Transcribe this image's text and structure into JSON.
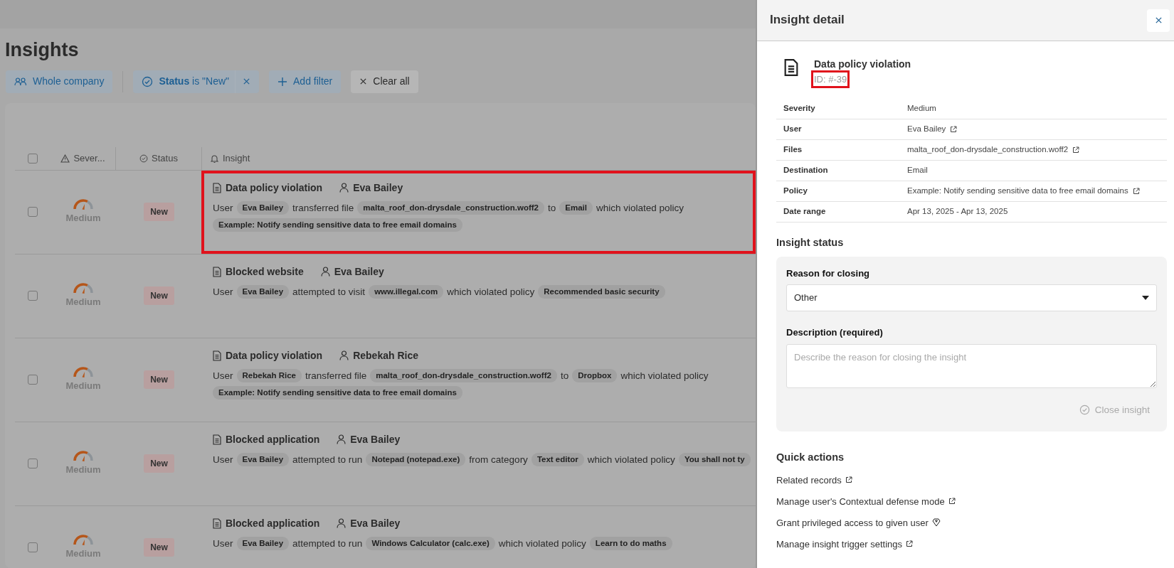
{
  "page": {
    "title": "Insights"
  },
  "filters": [
    {
      "kind": "scope",
      "label": "Whole company"
    },
    {
      "kind": "status",
      "label": "**Status** is \"New\"",
      "removable": true
    },
    {
      "kind": "add",
      "label": "Add filter"
    },
    {
      "kind": "clear",
      "label": "Clear all"
    }
  ],
  "table": {
    "select_all": {
      "checked": false
    },
    "columns": [
      {
        "kind": "severity",
        "label": "Sever..."
      },
      {
        "kind": "status",
        "label": "Status"
      },
      {
        "kind": "insight",
        "label": "Insight"
      }
    ],
    "rows": [
      {
        "checked": false,
        "severity": "Medium",
        "status": "New",
        "highlighted": true,
        "type": "Data policy violation",
        "user": "Eva Bailey",
        "lines": [
          [
            {
              "kind": "text",
              "text": "User"
            },
            {
              "kind": "chip",
              "text": "Eva Bailey"
            },
            {
              "kind": "text",
              "text": "transferred file"
            },
            {
              "kind": "chip",
              "text": "malta_roof_don-drysdale_construction.woff2"
            },
            {
              "kind": "text",
              "text": "to"
            },
            {
              "kind": "chip",
              "text": "Email"
            },
            {
              "kind": "text",
              "text": "which violated policy"
            }
          ],
          [
            {
              "kind": "chip",
              "text": "Example: Notify sending sensitive data to free email domains"
            }
          ]
        ]
      },
      {
        "checked": false,
        "severity": "Medium",
        "status": "New",
        "highlighted": false,
        "type": "Blocked website",
        "user": "Eva Bailey",
        "lines": [
          [
            {
              "kind": "text",
              "text": "User"
            },
            {
              "kind": "chip",
              "text": "Eva Bailey"
            },
            {
              "kind": "text",
              "text": "attempted to visit"
            },
            {
              "kind": "chip",
              "text": "www.illegal.com"
            },
            {
              "kind": "text",
              "text": "which violated policy"
            },
            {
              "kind": "chip",
              "text": "Recommended basic security"
            }
          ]
        ]
      },
      {
        "checked": false,
        "severity": "Medium",
        "status": "New",
        "highlighted": false,
        "type": "Data policy violation",
        "user": "Rebekah Rice",
        "lines": [
          [
            {
              "kind": "text",
              "text": "User"
            },
            {
              "kind": "chip",
              "text": "Rebekah Rice"
            },
            {
              "kind": "text",
              "text": "transferred file"
            },
            {
              "kind": "chip",
              "text": "malta_roof_don-drysdale_construction.woff2"
            },
            {
              "kind": "text",
              "text": "to"
            },
            {
              "kind": "chip",
              "text": "Dropbox"
            },
            {
              "kind": "text",
              "text": "which violated policy"
            }
          ],
          [
            {
              "kind": "chip",
              "text": "Example: Notify sending sensitive data to free email domains"
            }
          ]
        ]
      },
      {
        "checked": false,
        "severity": "Medium",
        "status": "New",
        "highlighted": false,
        "type": "Blocked application",
        "user": "Eva Bailey",
        "lines": [
          [
            {
              "kind": "text",
              "text": "User"
            },
            {
              "kind": "chip",
              "text": "Eva Bailey"
            },
            {
              "kind": "text",
              "text": "attempted to run"
            },
            {
              "kind": "chip",
              "text": "Notepad (notepad.exe)"
            },
            {
              "kind": "text",
              "text": "from category"
            },
            {
              "kind": "chip",
              "text": "Text editor"
            },
            {
              "kind": "text",
              "text": "which violated policy"
            },
            {
              "kind": "chip",
              "text": "You shall not ty"
            }
          ]
        ]
      },
      {
        "checked": false,
        "severity": "Medium",
        "status": "New",
        "highlighted": false,
        "type": "Blocked application",
        "user": "Eva Bailey",
        "lines": [
          [
            {
              "kind": "text",
              "text": "User"
            },
            {
              "kind": "chip",
              "text": "Eva Bailey"
            },
            {
              "kind": "text",
              "text": "attempted to run"
            },
            {
              "kind": "chip",
              "text": "Windows Calculator (calc.exe)"
            },
            {
              "kind": "text",
              "text": "which violated policy"
            },
            {
              "kind": "chip",
              "text": "Learn to do maths"
            }
          ]
        ]
      }
    ]
  },
  "panel": {
    "title": "Insight detail",
    "insight": {
      "type": "Data policy violation",
      "id": "ID: #-39",
      "highlighted": true
    },
    "details": [
      {
        "label": "Severity",
        "value": "Medium",
        "link": false
      },
      {
        "label": "User",
        "value": "Eva Bailey",
        "link": true
      },
      {
        "label": "Files",
        "value": "malta_roof_don-drysdale_construction.woff2",
        "link": true
      },
      {
        "label": "Destination",
        "value": "Email",
        "link": false
      },
      {
        "label": "Policy",
        "value": "Example: Notify sending sensitive data to free email domains",
        "link": true
      },
      {
        "label": "Date range",
        "value": "Apr 13, 2025 - Apr 13, 2025",
        "link": false
      }
    ],
    "status_section": {
      "heading": "Insight status",
      "reason_label": "Reason for closing",
      "reason_value": "Other",
      "description_label": "Description (required)",
      "description_placeholder": "Describe the reason for closing the insight",
      "close_button": {
        "label": "Close insight",
        "disabled": true
      }
    },
    "quick_actions": {
      "heading": "Quick actions",
      "items": [
        {
          "label": "Related records",
          "kind": "external"
        },
        {
          "label": "Manage user's Contextual defense mode",
          "kind": "external"
        },
        {
          "label": "Grant privileged access to given user",
          "kind": "premium"
        },
        {
          "label": "Manage insight trigger settings",
          "kind": "external"
        }
      ]
    }
  }
}
